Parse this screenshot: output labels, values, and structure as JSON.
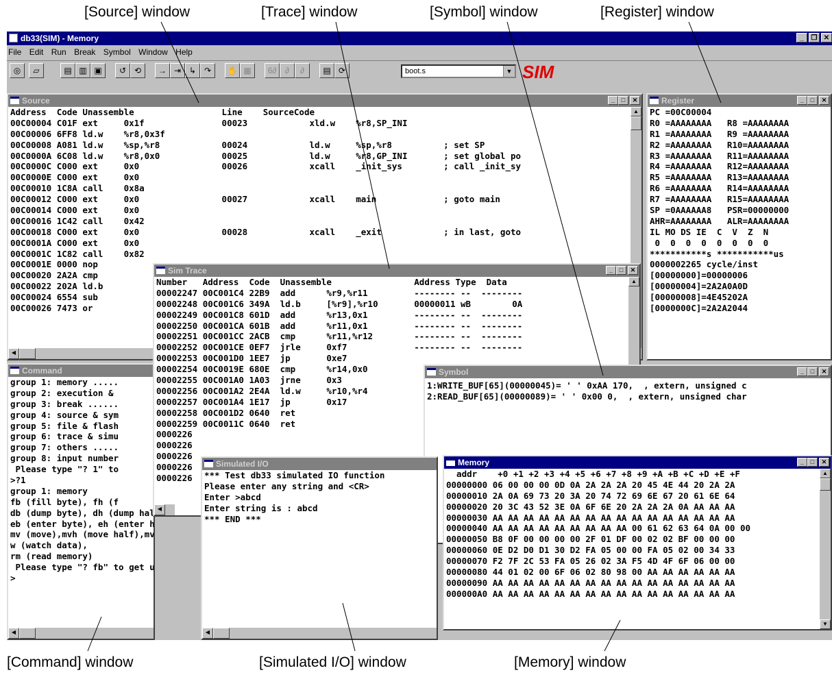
{
  "callouts": {
    "source": "[Source] window",
    "trace": "[Trace] window",
    "symbol": "[Symbol] window",
    "register": "[Register] window",
    "command": "[Command] window",
    "simio": "[Simulated I/O] window",
    "memory": "[Memory] window"
  },
  "app": {
    "title": "db33(SIM) - Memory",
    "menu": [
      "File",
      "Edit",
      "Run",
      "Break",
      "Symbol",
      "Window",
      "Help"
    ],
    "combo_value": "boot.s",
    "logo": "SIM"
  },
  "source": {
    "title": "Source",
    "lines": [
      "Address  Code Unassemble                 Line    SourceCode",
      "00C00004 C01F ext     0x1f               00023            xld.w    %r8,SP_INI",
      "00C00006 6FF8 ld.w    %r8,0x3f",
      "00C00008 A081 ld.w    %sp,%r8            00024            ld.w     %sp,%r8          ; set SP",
      "00C0000A 6C08 ld.w    %r8,0x0            00025            ld.w     %r8,GP_INI       ; set global po",
      "00C0000C C000 ext     0x0                00026            xcall    _init_sys        ; call _init_sy",
      "00C0000E C000 ext     0x0",
      "00C00010 1C8A call    0x8a",
      "00C00012 C000 ext     0x0                00027            xcall    main             ; goto main",
      "00C00014 C000 ext     0x0",
      "00C00016 1C42 call    0x42",
      "00C00018 C000 ext     0x0                00028            xcall    _exit            ; in last, goto",
      "00C0001A C000 ext     0x0",
      "00C0001C 1C82 call    0x82",
      "00C0001E 0000 nop",
      "00C00020 2A2A cmp",
      "00C00022 202A ld.b",
      "00C00024 6554 sub",
      "00C00026 7473 or"
    ]
  },
  "register": {
    "title": "Register",
    "lines": [
      "PC =00C00004",
      "R0 =AAAAAAAA   R8 =AAAAAAAA",
      "R1 =AAAAAAAA   R9 =AAAAAAAA",
      "R2 =AAAAAAAA   R10=AAAAAAAA",
      "R3 =AAAAAAAA   R11=AAAAAAAA",
      "R4 =AAAAAAAA   R12=AAAAAAAA",
      "R5 =AAAAAAAA   R13=AAAAAAAA",
      "R6 =AAAAAAAA   R14=AAAAAAAA",
      "R7 =AAAAAAAA   R15=AAAAAAAA",
      "SP =0AAAAAA8   PSR=00000000",
      "AHR=AAAAAAAA   ALR=AAAAAAAA",
      "IL MO DS IE  C  V  Z  N",
      " 0  0  0  0  0  0  0  0",
      "***********s ***********us",
      "0000002265 cycle/inst",
      "[00000000]=00000006",
      "[00000004]=2A2A0A0D",
      "[00000008]=4E45202A",
      "[0000000C]=2A2A2044"
    ]
  },
  "command": {
    "title": "Command",
    "lines": [
      "group 1: memory .....",
      "group 2: execution &",
      "group 3: break ......",
      "group 4: source & sym",
      "group 5: file & flash",
      "group 6: trace & simu",
      "group 7: others .....",
      "group 8: input number",
      " Please type \"? 1\" to",
      ">?1",
      "group 1: memory",
      "fb (fill byte), fh (f",
      "db (dump byte), dh (dump half",
      "eb (enter byte), eh (enter ha",
      "mv (move),mvh (move half),mvw",
      "w (watch data),",
      "rm (read memory)",
      " Please type \"? fb\" to get us",
      ">"
    ]
  },
  "trace": {
    "title": "Sim Trace",
    "lines": [
      "Number   Address  Code  Unassemble                Address Type  Data",
      "00002247 00C001C4 22B9  add      %r9,%r11         -------- --  --------",
      "00002248 00C001C6 349A  ld.b     [%r9],%r10       00000011 wB        0A",
      "00002249 00C001C8 601D  add      %r13,0x1         -------- --  --------",
      "00002250 00C001CA 601B  add      %r11,0x1         -------- --  --------",
      "00002251 00C001CC 2ACB  cmp      %r11,%r12        -------- --  --------",
      "00002252 00C001CE 0EF7  jrle     0xf7             -------- --  --------",
      "00002253 00C001D0 1EE7  jp       0xe7",
      "00002254 00C0019E 680E  cmp      %r14,0x0",
      "00002255 00C001A0 1A03  jrne     0x3",
      "00002256 00C001A2 2E4A  ld.w     %r10,%r4",
      "00002257 00C001A4 1E17  jp       0x17",
      "00002258 00C001D2 0640  ret",
      "00002259 00C0011C 0640  ret",
      "0000226",
      "0000226",
      "0000226",
      "0000226",
      "0000226"
    ]
  },
  "symbol": {
    "title": "Symbol",
    "lines": [
      "1:WRITE_BUF[65](00000045)= ' ' 0xAA 170,  , extern, unsigned c",
      "2:READ_BUF[65](00000089)= ' ' 0x00 0,  , extern, unsigned char"
    ]
  },
  "simio": {
    "title": "Simulated I/O",
    "lines": [
      "*** Test db33 simulated IO function",
      "Please enter any string and <CR>",
      "Enter >abcd",
      "Enter string is : abcd",
      "*** END ***"
    ]
  },
  "memory": {
    "title": "Memory",
    "lines": [
      "  addr    +0 +1 +2 +3 +4 +5 +6 +7 +8 +9 +A +B +C +D +E +F",
      "00000000 06 00 00 00 0D 0A 2A 2A 2A 20 45 4E 44 20 2A 2A",
      "00000010 2A 0A 69 73 20 3A 20 74 72 69 6E 67 20 61 6E 64",
      "00000020 20 3C 43 52 3E 0A 6F 6E 20 2A 2A 2A 0A AA AA AA",
      "00000030 AA AA AA AA AA AA AA AA AA AA AA AA AA AA AA AA",
      "00000040 AA AA AA AA AA AA AA AA AA 00 61 62 63 64 0A 00 00",
      "00000050 B8 0F 00 00 00 00 2F 01 DF 00 02 02 BF 00 00 00",
      "00000060 0E D2 D0 D1 30 D2 FA 05 00 00 FA 05 02 00 34 33",
      "00000070 F2 7F 2C 53 FA 05 26 02 3A F5 4D 4F 6F 06 00 00",
      "00000080 44 01 02 00 6F 06 02 80 98 00 AA AA AA AA AA AA",
      "00000090 AA AA AA AA AA AA AA AA AA AA AA AA AA AA AA AA",
      "000000A0 AA AA AA AA AA AA AA AA AA AA AA AA AA AA AA AA"
    ]
  }
}
